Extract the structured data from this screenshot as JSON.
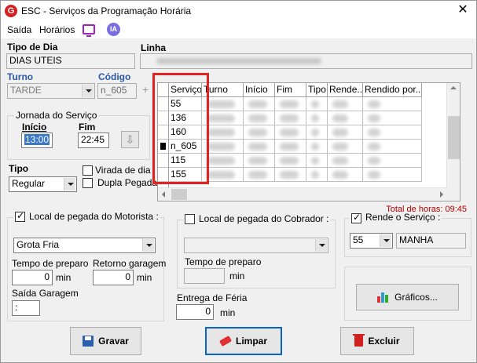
{
  "window": {
    "title": "ESC - Serviços da Programação Horária",
    "app_icon_letter": "G",
    "close_glyph": "✕"
  },
  "menu": {
    "items": [
      "Saída",
      "Horários"
    ],
    "ia_label": "IA"
  },
  "tipo_dia": {
    "label": "Tipo de Dia",
    "value": "DIAS UTEIS"
  },
  "linha": {
    "label": "Linha",
    "value": ""
  },
  "turno": {
    "label": "Turno",
    "value": "TARDE"
  },
  "codigo": {
    "label": "Código",
    "value": "n_605",
    "plus": "+"
  },
  "jornada": {
    "title": "Jornada do Serviço",
    "inicio_label": "Início",
    "inicio_value": "13:00",
    "fim_label": "Fim",
    "fim_value": "22:45",
    "btn_glyph": "⇩"
  },
  "tipo": {
    "label": "Tipo",
    "value": "Regular"
  },
  "virada_dia": {
    "label": "Virada de dia",
    "checked": false
  },
  "dupla_pegada": {
    "label": "Dupla Pegada",
    "checked": false
  },
  "grid": {
    "columns": [
      "Serviço",
      "Turno",
      "Início",
      "Fim",
      "Tipo",
      "Rende...",
      "Rendido por..."
    ],
    "rows": [
      {
        "servico": "55"
      },
      {
        "servico": "136"
      },
      {
        "servico": "160"
      },
      {
        "servico": "n_605"
      },
      {
        "servico": "115"
      },
      {
        "servico": "155"
      }
    ],
    "current_row": 3
  },
  "total_horas": "Total de horas: 09:45",
  "motorista": {
    "label": "Local de pegada do Motorista :",
    "checked": true,
    "local": "Grota Fria",
    "tempo_preparo_label": "Tempo de preparo",
    "tempo_preparo_value": "0",
    "retorno_label": "Retorno garagem",
    "retorno_value": "0",
    "min_label": "min",
    "saida_label": "Saída Garagem",
    "saida_value": ":"
  },
  "cobrador": {
    "label": "Local de pegada do Cobrador :",
    "checked": false,
    "local": "",
    "tempo_preparo_label": "Tempo de preparo",
    "tempo_preparo_value": "",
    "min_label": "min"
  },
  "ferias": {
    "label": "Entrega de Féria",
    "value": "0",
    "min_label": "min"
  },
  "rende": {
    "label": "Rende o Serviço :",
    "checked": true,
    "servico": "55",
    "turno": "MANHA"
  },
  "buttons": {
    "graficos": "Gráficos...",
    "gravar": "Gravar",
    "limpar": "Limpar",
    "excluir": "Excluir"
  }
}
